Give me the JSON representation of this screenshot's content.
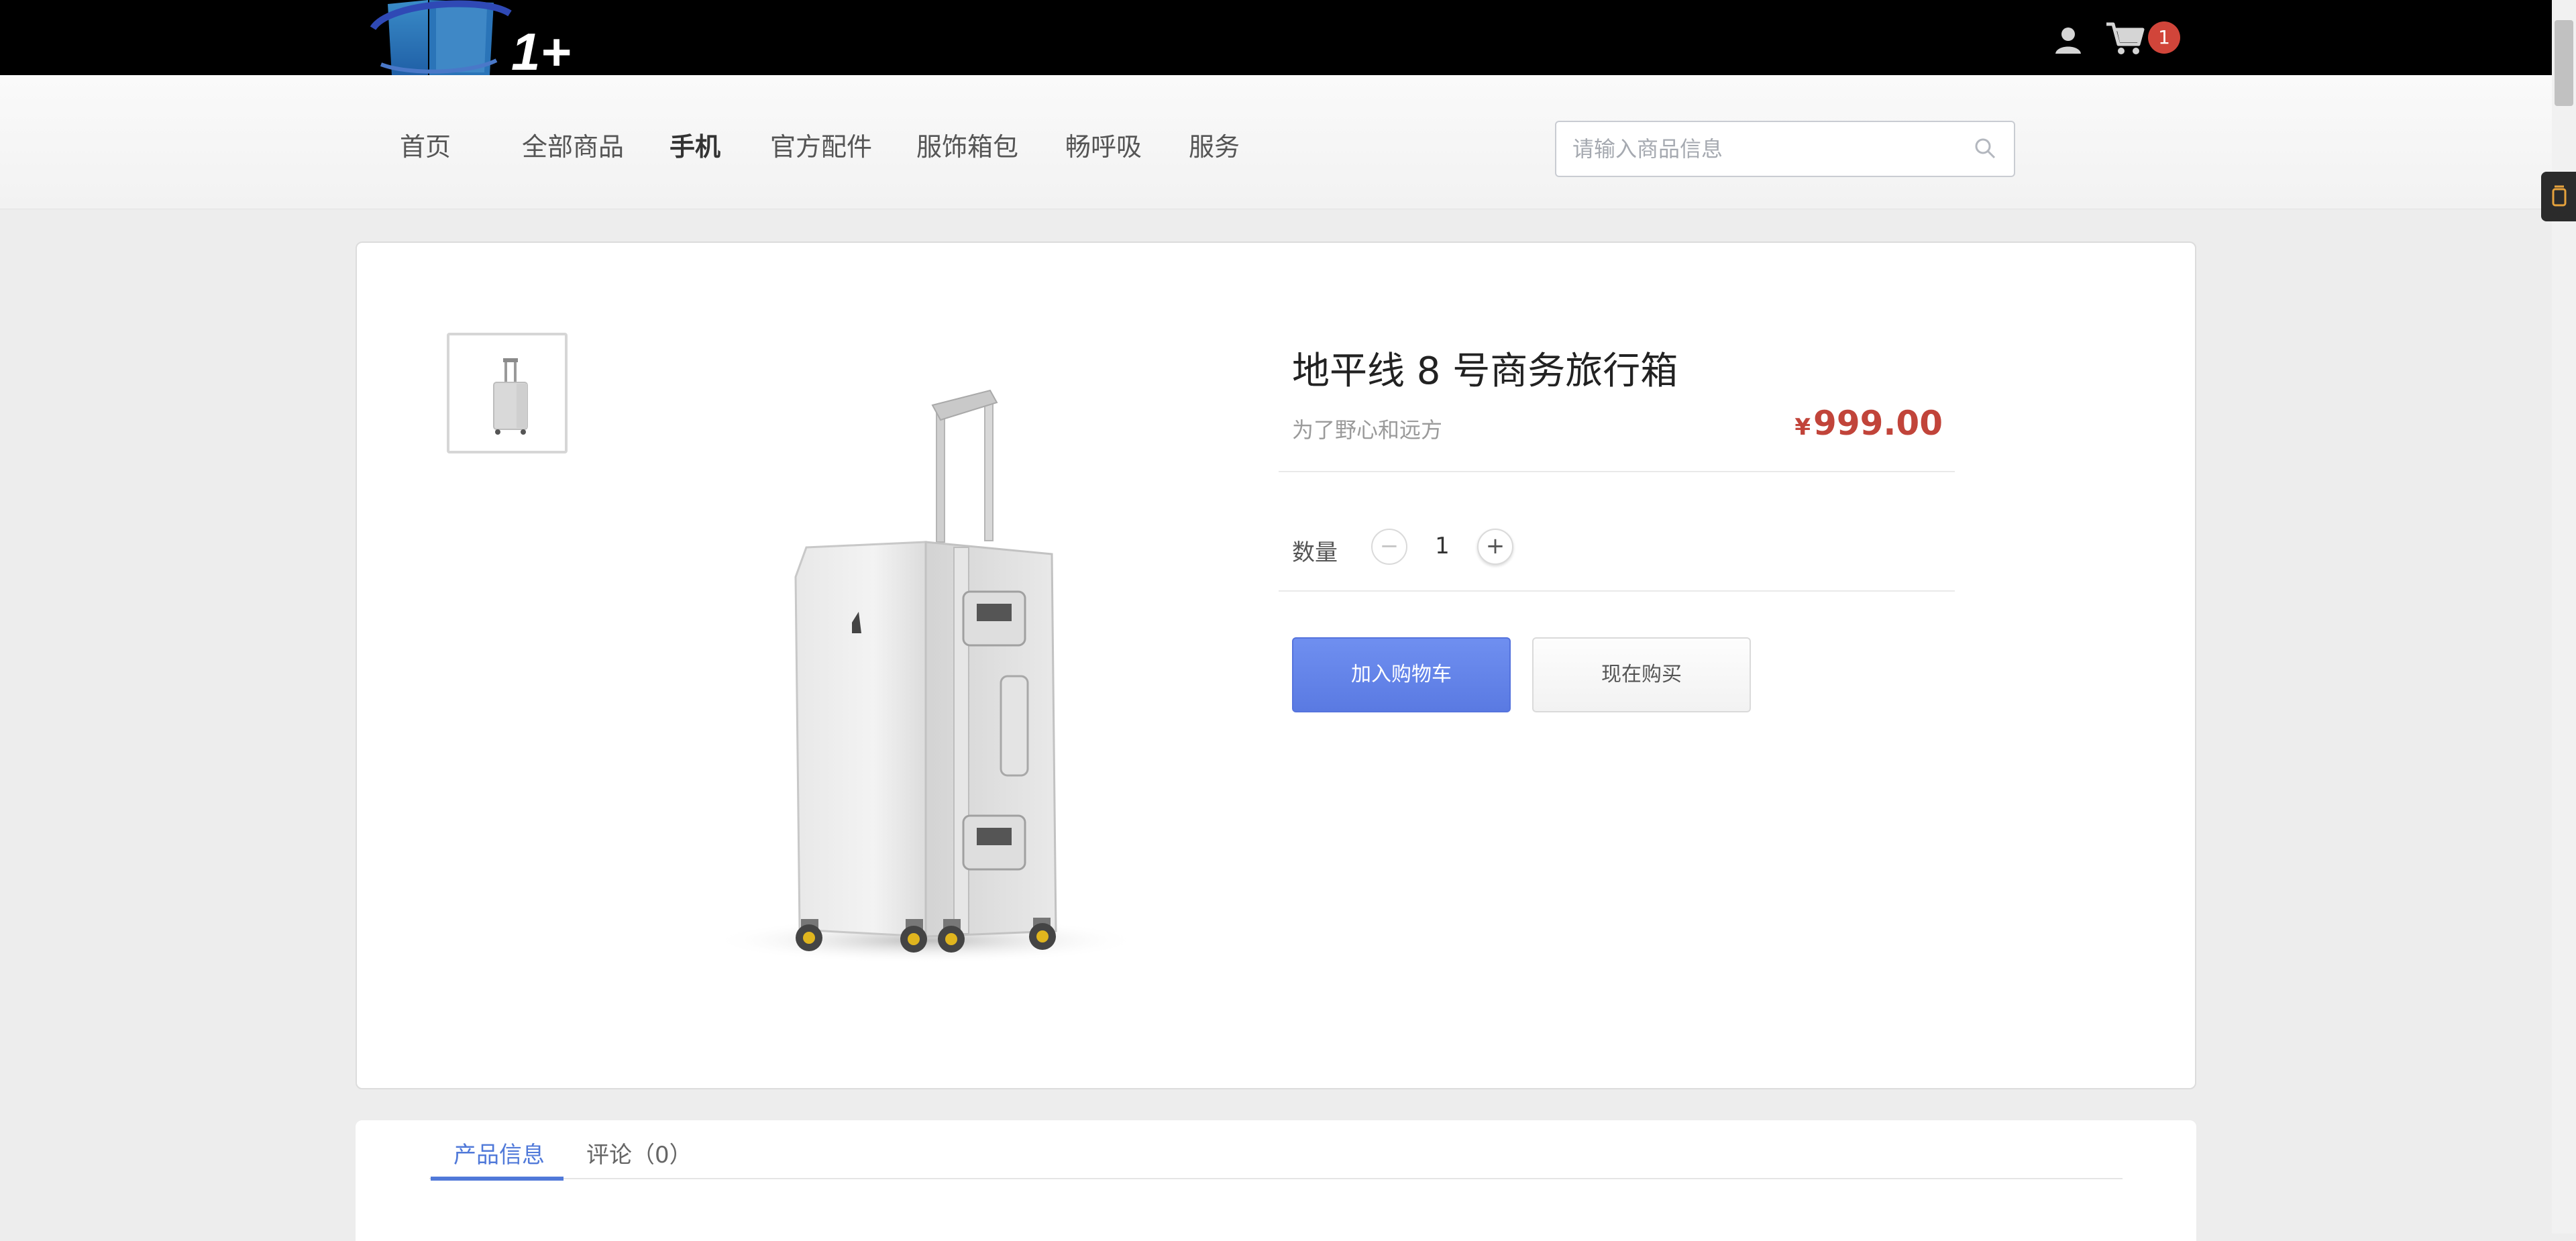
{
  "header": {
    "logo_text": "1+",
    "cart_count": "1",
    "icons": [
      "logo-icon",
      "user-icon",
      "cart-icon"
    ]
  },
  "nav": {
    "items": [
      {
        "label": "首页",
        "active": false
      },
      {
        "label": "全部商品",
        "active": false
      },
      {
        "label": "手机",
        "active": true
      },
      {
        "label": "官方配件",
        "active": false
      },
      {
        "label": "服饰箱包",
        "active": false
      },
      {
        "label": "畅呼吸",
        "active": false
      },
      {
        "label": "服务",
        "active": false
      }
    ],
    "search_placeholder": "请输入商品信息"
  },
  "product": {
    "title": "地平线 8 号商务旅行箱",
    "subtitle": "为了野心和远方",
    "currency_symbol": "¥",
    "price": "999.00",
    "quantity_label": "数量",
    "quantity": "1",
    "minus_symbol": "−",
    "plus_symbol": "+",
    "add_to_cart_label": "加入购物车",
    "buy_now_label": "现在购买"
  },
  "tabs": [
    {
      "label": "产品信息",
      "active": true
    },
    {
      "label": "评论（0）",
      "active": false
    }
  ],
  "colors": {
    "accent_blue": "#5079d9",
    "price_red": "#c1443a",
    "badge_red": "#d1453a",
    "topbar_black": "#000000"
  }
}
